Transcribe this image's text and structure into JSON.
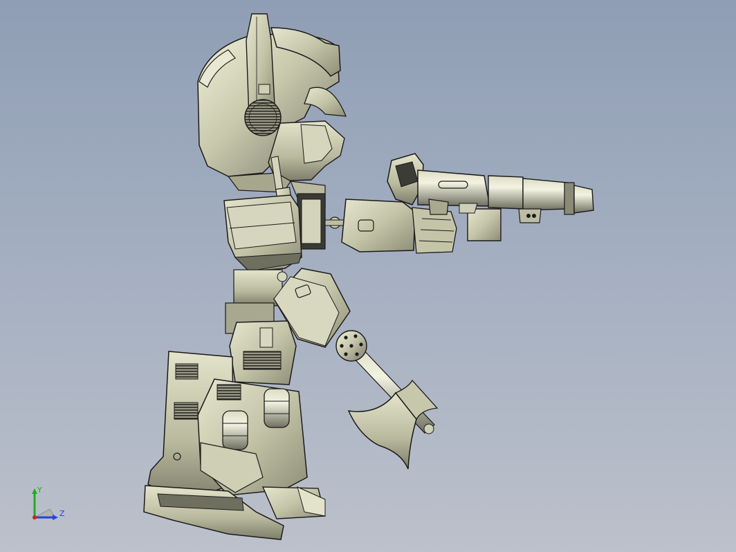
{
  "viewport": {
    "model_colors": {
      "background_top": "#8f9eb5",
      "background_bottom": "#bcc1cb",
      "part_fill": "#c9c9ae",
      "part_shade": "#8d8d78",
      "edge": "#1a1a1a"
    }
  },
  "triad": {
    "y_label": "Y",
    "z_label": "Z",
    "y_color": "#22aa22",
    "z_color": "#2244dd",
    "x_color": "#cc2222"
  }
}
